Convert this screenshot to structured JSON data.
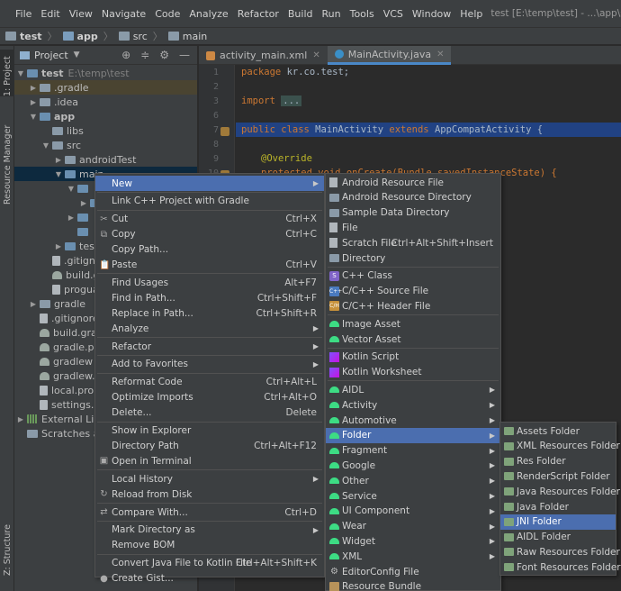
{
  "menubar": {
    "items": [
      "File",
      "Edit",
      "View",
      "Navigate",
      "Code",
      "Analyze",
      "Refactor",
      "Build",
      "Run",
      "Tools",
      "VCS",
      "Window",
      "Help"
    ],
    "window_title": "test [E:\\temp\\test] - ...\\app\\src\\main\\java\\kr"
  },
  "navbar": {
    "crumbs": [
      "test",
      "app",
      "src",
      "main"
    ]
  },
  "left_strip": {
    "tabs": [
      "1: Project",
      "Resource Manager",
      "Z: Structure"
    ]
  },
  "project_panel": {
    "title": "Project",
    "tree": [
      {
        "label": "test",
        "extra": "E:\\temp\\test",
        "level": 0,
        "arrow": "▼"
      },
      {
        "label": ".gradle",
        "level": 1,
        "arrow": "▶"
      },
      {
        "label": ".idea",
        "level": 1,
        "arrow": "▶"
      },
      {
        "label": "app",
        "level": 1,
        "arrow": "▼"
      },
      {
        "label": "libs",
        "level": 2,
        "arrow": ""
      },
      {
        "label": "src",
        "level": 2,
        "arrow": "▼"
      },
      {
        "label": "androidTest",
        "level": 3,
        "arrow": "▶"
      },
      {
        "label": "main",
        "level": 3,
        "arrow": "▼"
      },
      {
        "label": "",
        "level": 4,
        "arrow": "▼"
      },
      {
        "label": "",
        "level": 5,
        "arrow": "▶"
      },
      {
        "label": "",
        "level": 4,
        "arrow": "▶"
      },
      {
        "label": "",
        "level": 4,
        "arrow": ""
      },
      {
        "label": "test",
        "level": 3,
        "arrow": "▶"
      },
      {
        "label": ".gitigno",
        "level": 2,
        "arrow": ""
      },
      {
        "label": "build.g",
        "level": 2,
        "arrow": ""
      },
      {
        "label": "progua",
        "level": 2,
        "arrow": ""
      },
      {
        "label": "gradle",
        "level": 1,
        "arrow": "▶"
      },
      {
        "label": ".gitignore",
        "level": 1,
        "arrow": ""
      },
      {
        "label": "build.grad",
        "level": 1,
        "arrow": ""
      },
      {
        "label": "gradle.pro",
        "level": 1,
        "arrow": ""
      },
      {
        "label": "gradlew",
        "level": 1,
        "arrow": ""
      },
      {
        "label": "gradlew.ba",
        "level": 1,
        "arrow": ""
      },
      {
        "label": "local.prop",
        "level": 1,
        "arrow": ""
      },
      {
        "label": "settings.gr",
        "level": 1,
        "arrow": ""
      },
      {
        "label": "External Libra",
        "level": 0,
        "arrow": "▶"
      },
      {
        "label": "Scratches and",
        "level": 0,
        "arrow": ""
      }
    ]
  },
  "editor": {
    "tabs": [
      {
        "label": "activity_main.xml"
      },
      {
        "label": "MainActivity.java"
      }
    ],
    "line_numbers": [
      "1",
      "2",
      "3",
      "6",
      "7",
      "8",
      "9",
      "10"
    ],
    "code": {
      "l1_kw": "package",
      "l1_rest": " kr.co.test;",
      "l3_kw": "import",
      "l3_fold": "...",
      "l7_kw": "public class",
      "l7_cls": " MainActivity ",
      "l7_kw2": "extends",
      "l7_rest": " AppCompatActivity {",
      "l9_ann": "@Override",
      "l10": "protected void onCreate(Bundle savedInstanceState) {"
    }
  },
  "context_menu": {
    "items": [
      {
        "label": "New",
        "submenu": true,
        "selected": true
      },
      {
        "sep": true
      },
      {
        "label": "Link C++ Project with Gradle"
      },
      {
        "sep": true
      },
      {
        "label": "Cut",
        "shortcut": "Ctrl+X",
        "icon": "✂"
      },
      {
        "label": "Copy",
        "shortcut": "Ctrl+C",
        "icon": "⧉"
      },
      {
        "label": "Copy Path...",
        "shortcut": ""
      },
      {
        "label": "Paste",
        "shortcut": "Ctrl+V",
        "icon": "📋"
      },
      {
        "sep": true
      },
      {
        "label": "Find Usages",
        "shortcut": "Alt+F7"
      },
      {
        "label": "Find in Path...",
        "shortcut": "Ctrl+Shift+F"
      },
      {
        "label": "Replace in Path...",
        "shortcut": "Ctrl+Shift+R"
      },
      {
        "label": "Analyze",
        "submenu": true
      },
      {
        "sep": true
      },
      {
        "label": "Refactor",
        "submenu": true
      },
      {
        "sep": true
      },
      {
        "label": "Add to Favorites",
        "submenu": true
      },
      {
        "sep": true
      },
      {
        "label": "Reformat Code",
        "shortcut": "Ctrl+Alt+L"
      },
      {
        "label": "Optimize Imports",
        "shortcut": "Ctrl+Alt+O"
      },
      {
        "label": "Delete...",
        "shortcut": "Delete"
      },
      {
        "sep": true
      },
      {
        "label": "Show in Explorer"
      },
      {
        "label": "Directory Path",
        "shortcut": "Ctrl+Alt+F12"
      },
      {
        "label": "Open in Terminal",
        "icon": "▣"
      },
      {
        "sep": true
      },
      {
        "label": "Local History",
        "submenu": true
      },
      {
        "label": "Reload from Disk",
        "icon": "↻"
      },
      {
        "sep": true
      },
      {
        "label": "Compare With...",
        "shortcut": "Ctrl+D",
        "icon": "⇄"
      },
      {
        "sep": true
      },
      {
        "label": "Mark Directory as",
        "submenu": true
      },
      {
        "label": "Remove BOM"
      },
      {
        "sep": true
      },
      {
        "label": "Convert Java File to Kotlin File",
        "shortcut": "Ctrl+Alt+Shift+K"
      },
      {
        "label": "Create Gist...",
        "icon": "●"
      }
    ]
  },
  "new_menu": {
    "items": [
      {
        "label": "Android Resource File",
        "icon": "file"
      },
      {
        "label": "Android Resource Directory",
        "icon": "folder"
      },
      {
        "label": "Sample Data Directory",
        "icon": "folder"
      },
      {
        "label": "File",
        "icon": "file"
      },
      {
        "label": "Scratch File",
        "shortcut": "Ctrl+Alt+Shift+Insert",
        "icon": "file"
      },
      {
        "label": "Directory",
        "icon": "folder"
      },
      {
        "sep": true
      },
      {
        "label": "C++ Class",
        "icon": "cpp"
      },
      {
        "label": "C/C++ Source File",
        "icon": "cpp2"
      },
      {
        "label": "C/C++ Header File",
        "icon": "cpp3"
      },
      {
        "sep": true
      },
      {
        "label": "Image Asset",
        "icon": "droid"
      },
      {
        "label": "Vector Asset",
        "icon": "droid"
      },
      {
        "sep": true
      },
      {
        "label": "Kotlin Script",
        "icon": "kt"
      },
      {
        "label": "Kotlin Worksheet",
        "icon": "kt"
      },
      {
        "sep": true
      },
      {
        "label": "AIDL",
        "icon": "droid",
        "submenu": true
      },
      {
        "label": "Activity",
        "icon": "droid",
        "submenu": true
      },
      {
        "label": "Automotive",
        "icon": "droid",
        "submenu": true
      },
      {
        "label": "Folder",
        "icon": "droid",
        "submenu": true,
        "selected": true
      },
      {
        "label": "Fragment",
        "icon": "droid",
        "submenu": true
      },
      {
        "label": "Google",
        "icon": "droid",
        "submenu": true
      },
      {
        "label": "Other",
        "icon": "droid",
        "submenu": true
      },
      {
        "label": "Service",
        "icon": "droid",
        "submenu": true
      },
      {
        "label": "UI Component",
        "icon": "droid",
        "submenu": true
      },
      {
        "label": "Wear",
        "icon": "droid",
        "submenu": true
      },
      {
        "label": "Widget",
        "icon": "droid",
        "submenu": true
      },
      {
        "label": "XML",
        "icon": "droid",
        "submenu": true
      },
      {
        "label": "EditorConfig File",
        "icon": "ed"
      },
      {
        "label": "Resource Bundle",
        "icon": "rb"
      }
    ]
  },
  "folder_menu": {
    "items": [
      {
        "label": "Assets Folder"
      },
      {
        "label": "XML Resources Folder"
      },
      {
        "label": "Res Folder"
      },
      {
        "label": "RenderScript Folder"
      },
      {
        "label": "Java Resources Folder"
      },
      {
        "label": "Java Folder"
      },
      {
        "label": "JNI Folder",
        "selected": true
      },
      {
        "label": "AIDL Folder"
      },
      {
        "label": "Raw Resources Folder"
      },
      {
        "label": "Font Resources Folder"
      }
    ]
  },
  "colors": {
    "selection": "#4b6eaf",
    "menu_bg": "#3c3f41",
    "editor_bg": "#2b2b2b",
    "android_green": "#3ddc84"
  }
}
